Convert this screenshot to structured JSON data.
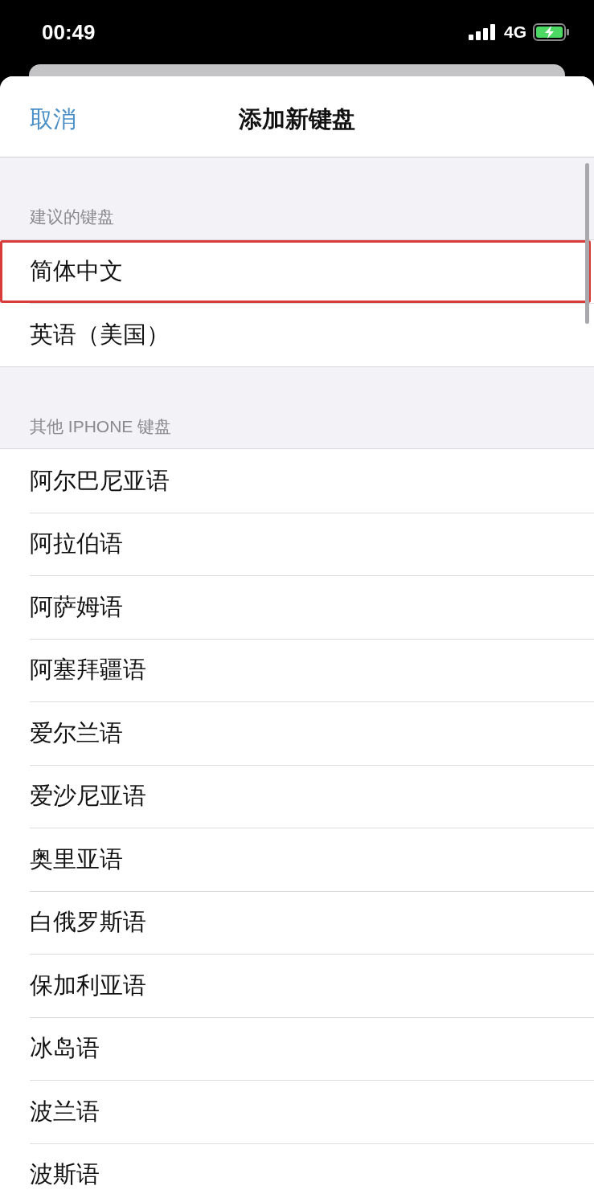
{
  "status_bar": {
    "time": "00:49",
    "network": "4G",
    "charging": true
  },
  "nav": {
    "cancel": "取消",
    "title": "添加新键盘"
  },
  "sections": [
    {
      "header": "建议的键盘",
      "items": [
        {
          "label": "简体中文",
          "highlighted": true
        },
        {
          "label": "英语（美国）",
          "highlighted": false
        }
      ]
    },
    {
      "header": "其他 IPHONE 键盘",
      "items": [
        {
          "label": "阿尔巴尼亚语",
          "highlighted": false
        },
        {
          "label": "阿拉伯语",
          "highlighted": false
        },
        {
          "label": "阿萨姆语",
          "highlighted": false
        },
        {
          "label": "阿塞拜疆语",
          "highlighted": false
        },
        {
          "label": "爱尔兰语",
          "highlighted": false
        },
        {
          "label": "爱沙尼亚语",
          "highlighted": false
        },
        {
          "label": "奥里亚语",
          "highlighted": false
        },
        {
          "label": "白俄罗斯语",
          "highlighted": false
        },
        {
          "label": "保加利亚语",
          "highlighted": false
        },
        {
          "label": "冰岛语",
          "highlighted": false
        },
        {
          "label": "波兰语",
          "highlighted": false
        },
        {
          "label": "波斯语",
          "highlighted": false
        }
      ]
    }
  ]
}
